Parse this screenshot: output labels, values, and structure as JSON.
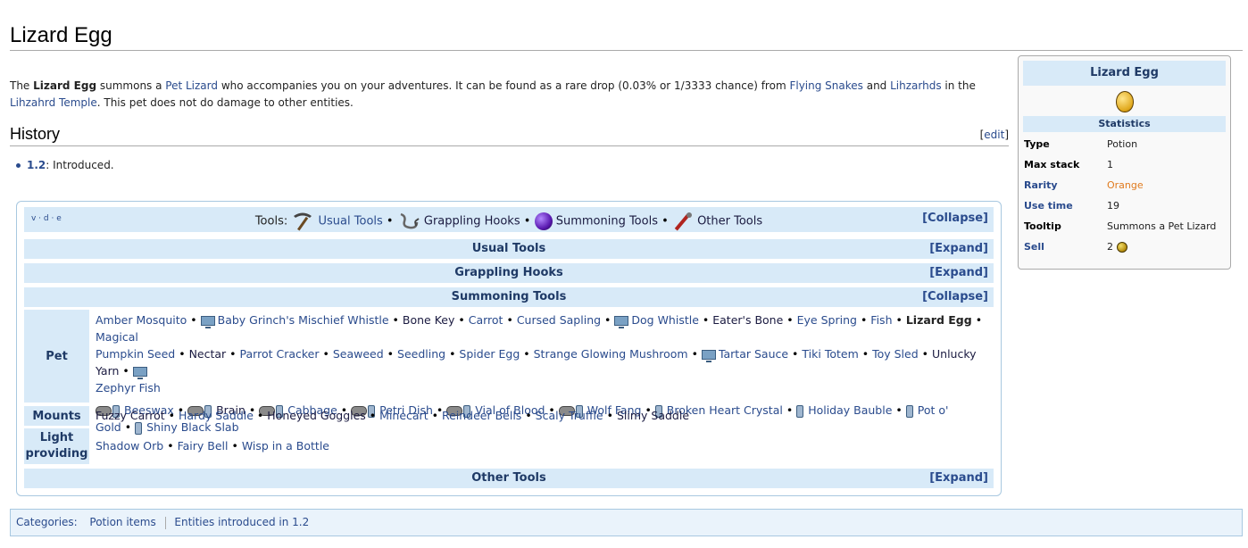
{
  "page": {
    "title": "Lizard Egg",
    "intro": {
      "p1": "The ",
      "bold": "Lizard Egg",
      "p2": " summons a ",
      "link1": "Pet Lizard",
      "p3": " who accompanies you on your adventures. It can be found as a rare drop (0.03% or 1/3333 chance) from ",
      "link2": "Flying Snakes",
      "p4": " and ",
      "link3": "Lihzarhds",
      "p5": " in the ",
      "link4": "Lihzahrd Temple",
      "p6": ". This pet does not do damage to other entities."
    },
    "history": {
      "heading": "History",
      "edit_label": "edit",
      "items": [
        {
          "version": "1.2",
          "text": ": Introduced."
        }
      ]
    }
  },
  "infobox": {
    "title": "Lizard Egg",
    "section": "Statistics",
    "rows": [
      {
        "key": "Type",
        "value": "Potion"
      },
      {
        "key": "Max stack",
        "value": "1"
      },
      {
        "key": "Rarity",
        "value": "Orange"
      },
      {
        "key": "Use time",
        "value": "19"
      },
      {
        "key": "Tooltip",
        "value": "Summons a Pet Lizard"
      },
      {
        "key": "Sell",
        "value": "2"
      }
    ]
  },
  "navbox": {
    "vde": "v · d · e",
    "tools_label": "Tools:",
    "head_links": [
      "Usual Tools",
      "Grappling Hooks",
      "Summoning Tools",
      "Other Tools"
    ],
    "collapse_label": "[Collapse]",
    "sections": {
      "usual": {
        "title": "Usual Tools",
        "toggle": "[Expand]"
      },
      "grappling": {
        "title": "Grappling Hooks",
        "toggle": "[Expand]"
      },
      "summoning": {
        "title": "Summoning Tools",
        "toggle": "[Collapse]"
      },
      "other": {
        "title": "Other Tools",
        "toggle": "[Expand]"
      }
    },
    "groups": {
      "pet": {
        "label": "Pet",
        "line1": [
          "Amber Mosquito",
          "Baby Grinch's Mischief Whistle",
          "Bone Key",
          "Carrot",
          "Cursed Sapling",
          "Dog Whistle",
          "Eater's Bone",
          "Eye Spring",
          "Fish",
          "Lizard Egg",
          "Magical"
        ],
        "line2": [
          "Pumpkin Seed",
          "Nectar",
          "Parrot Cracker",
          "Seaweed",
          "Seedling",
          "Spider Egg",
          "Strange Glowing Mushroom",
          "Tartar Sauce",
          "Tiki Totem",
          "Toy Sled",
          "Unlucky Yarn"
        ],
        "line3": [
          "Zephyr Fish"
        ],
        "line4": [
          "Beeswax",
          "Brain",
          "Cabbage",
          "Petri Dish",
          "Vial of Blood",
          "Wolf Fang",
          "Broken Heart Crystal",
          "Holiday Bauble",
          "Pot o'"
        ],
        "line5": [
          "Gold",
          "Shiny Black Slab"
        ]
      },
      "mounts": {
        "label": "Mounts",
        "items": [
          "Fuzzy Carrot",
          "Hardy Saddle",
          "Honeyed Goggles",
          "Minecart",
          "Reindeer Bells",
          "Scaly Truffle",
          "Slimy Saddle"
        ]
      },
      "light": {
        "label": "Light providing",
        "items": [
          "Shadow Orb",
          "Fairy Bell",
          "Wisp in a Bottle"
        ]
      }
    }
  },
  "categories": {
    "label": "Categories:",
    "items": [
      "Potion items",
      "Entities introduced in 1.2"
    ]
  },
  "colors": {
    "accent": "#2a4b8d",
    "header_bg": "#d8eaf8",
    "rarity_orange": "#e07a1e"
  }
}
